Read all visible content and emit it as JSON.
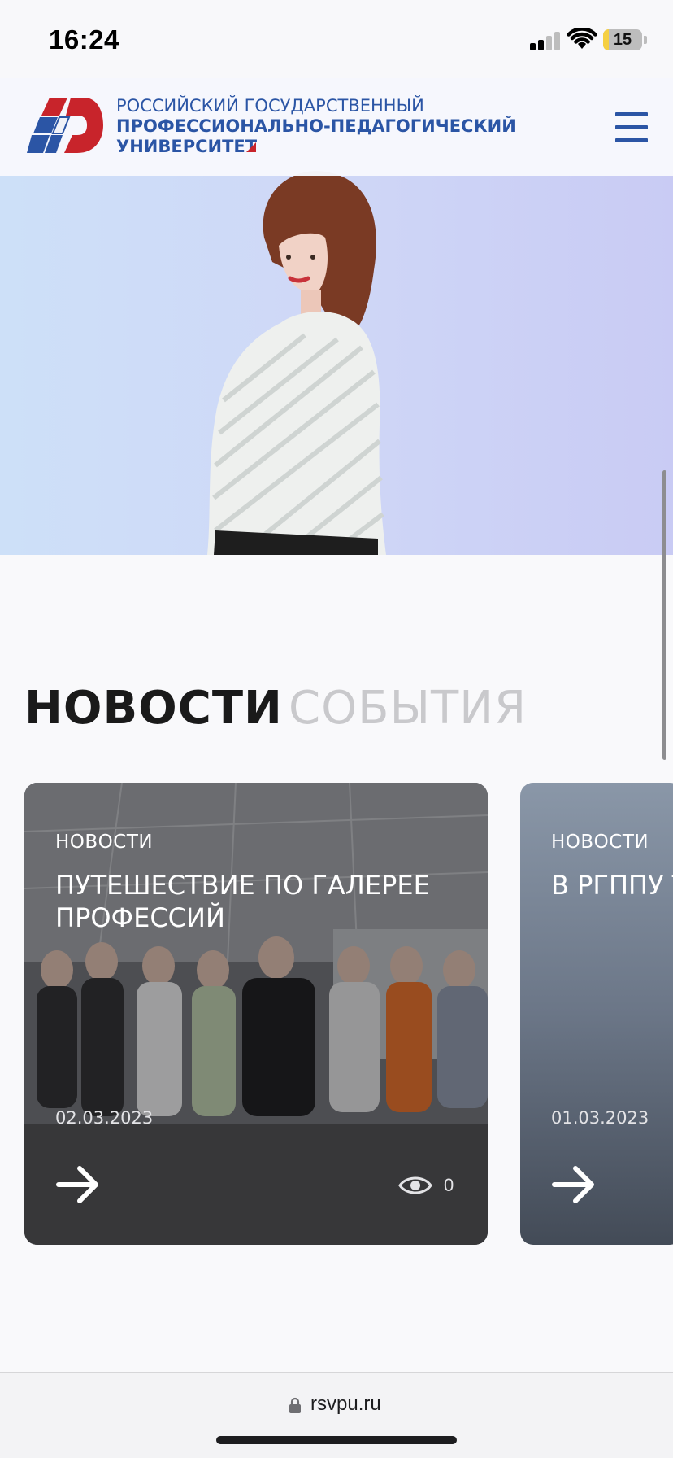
{
  "status_bar": {
    "time": "16:24",
    "battery_level": "15",
    "battery_fraction": 0.15,
    "signal_icon": "cellular-signal-icon",
    "wifi_icon": "wifi-icon"
  },
  "header": {
    "logo_line_1": "РОССИЙСКИЙ ГОСУДАРСТВЕННЫЙ",
    "logo_line_2": "ПРОФЕССИОНАЛЬНО-ПЕДАГОГИЧЕСКИЙ",
    "logo_line_3": "УНИВЕРСИТЕТ",
    "menu_icon": "hamburger-menu-icon",
    "brand_blue": "#2b55a5",
    "brand_red": "#c8242b"
  },
  "tabs": [
    {
      "label": "НОВОСТИ",
      "active": true
    },
    {
      "label": "СОБЫТИЯ",
      "active": false
    }
  ],
  "news": [
    {
      "category": "НОВОСТИ",
      "title": "ПУТЕШЕСТВИЕ ПО ГАЛЕРЕЕ ПРОФЕССИЙ",
      "date": "02.03.2023",
      "views": "0"
    },
    {
      "category": "НОВОСТИ",
      "title": "В РГППУ ТОРЖЕСТ ЦЕРЕМОН ГОСУДАР",
      "date": "01.03.2023"
    }
  ],
  "browser": {
    "url": "rsvpu.ru",
    "lock_icon": "lock-icon"
  }
}
